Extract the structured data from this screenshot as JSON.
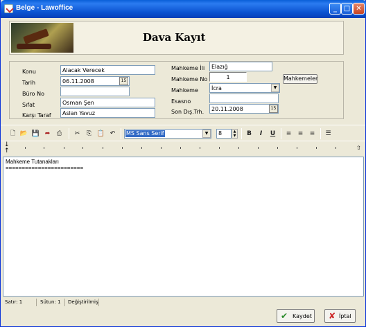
{
  "window": {
    "title": "Belge - Lawoffice",
    "min": "_",
    "max": "□",
    "close": "✕"
  },
  "header": {
    "title": "Dava Kayıt"
  },
  "form": {
    "konu_label": "Konu",
    "konu_value": "Alacak Verecek",
    "tarih_label": "Tarih",
    "tarih_value": "06.11.2008",
    "buro_label": "Büro No",
    "buro_value": "",
    "sifat_label": "Sıfat",
    "sifat_value": "Osman Şen",
    "karsi_label": "Karşı Taraf",
    "karsi_value": "Aslan Yavuz",
    "il_label": "Mahkeme İli",
    "il_value": "Elazığ",
    "no_label": "Mahkeme No",
    "no_value": "1",
    "mahkemeler_button": "Mahkemeler",
    "mahkeme_label": "Mahkeme",
    "mahkeme_value": "İcra",
    "esasno_label": "Esasno",
    "esasno_value": "",
    "son_label": "Son Dış.Trh.",
    "son_value": "20.11.2008"
  },
  "toolbar": {
    "font": "MS Sans Serif",
    "size": "8",
    "bold": "B",
    "italic": "I",
    "underline": "U"
  },
  "editor": {
    "line1": "Mahkeme Tutanakları",
    "line2": "========================"
  },
  "status": {
    "satir": "Satır: 1",
    "sutun": "Sütun: 1",
    "state": "Değiştirilmiş"
  },
  "buttons": {
    "save": "Kaydet",
    "cancel": "İptal"
  }
}
